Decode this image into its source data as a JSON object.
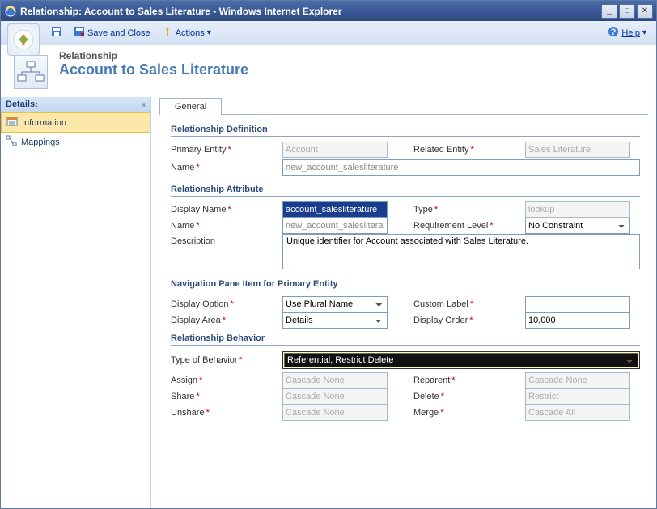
{
  "window": {
    "title": "Relationship: Account to Sales Literature - Windows Internet Explorer"
  },
  "toolbar": {
    "save_close": "Save and Close",
    "actions": "Actions",
    "help": "Help"
  },
  "header": {
    "kind": "Relationship",
    "title": "Account to Sales Literature"
  },
  "sidebar": {
    "header": "Details:",
    "items": [
      "Information",
      "Mappings"
    ]
  },
  "tab": {
    "general": "General"
  },
  "sections": {
    "def": "Relationship Definition",
    "attr": "Relationship Attribute",
    "nav": "Navigation Pane Item for Primary Entity",
    "beh": "Relationship Behavior"
  },
  "labels": {
    "primary_entity": "Primary Entity",
    "related_entity": "Related Entity",
    "name": "Name",
    "display_name": "Display Name",
    "type": "Type",
    "req_level": "Requirement Level",
    "description": "Description",
    "display_option": "Display Option",
    "custom_label": "Custom Label",
    "display_area": "Display Area",
    "display_order": "Display Order",
    "type_behavior": "Type of Behavior",
    "assign": "Assign",
    "reparent": "Reparent",
    "share": "Share",
    "delete": "Delete",
    "unshare": "Unshare",
    "merge": "Merge"
  },
  "values": {
    "primary_entity": "Account",
    "related_entity": "Sales Literature",
    "rel_name": "new_account_salesliterature",
    "display_name": "account_salesliterature",
    "attr_name": "new_account_salesliterature",
    "type": "lookup",
    "req_level": "No Constraint",
    "description": "Unique identifier for Account associated with Sales Literature.",
    "display_option": "Use Plural Name",
    "custom_label": "",
    "display_area": "Details",
    "display_order": "10,000",
    "type_behavior": "Referential, Restrict Delete",
    "assign": "Cascade None",
    "reparent": "Cascade None",
    "share": "Cascade None",
    "delete": "Restrict",
    "unshare": "Cascade None",
    "merge": "Cascade All"
  }
}
